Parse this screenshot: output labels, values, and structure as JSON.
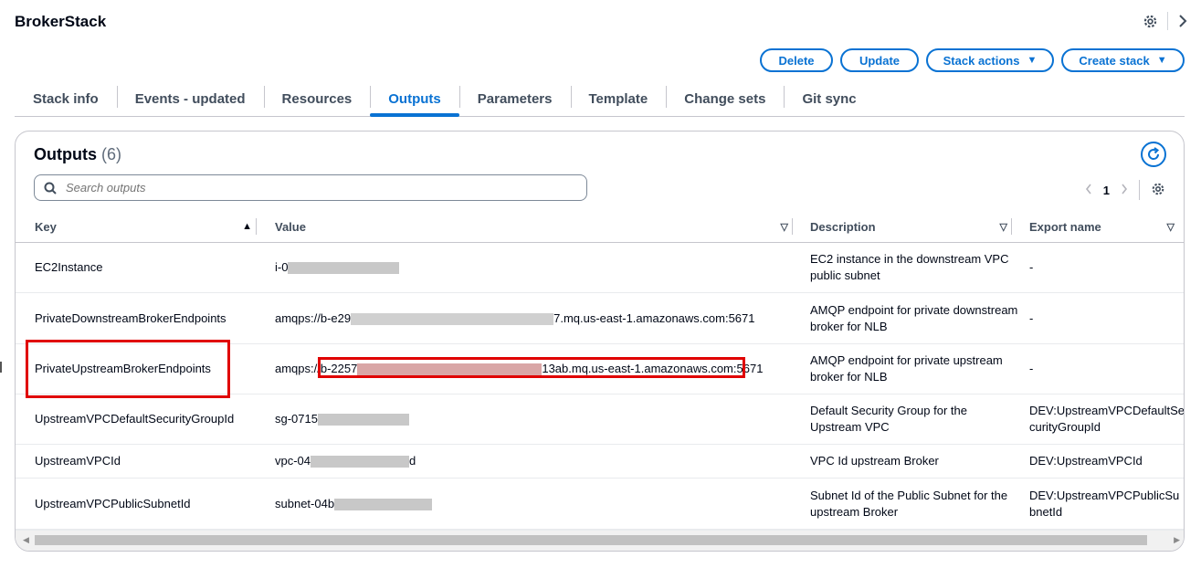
{
  "header": {
    "title": "BrokerStack"
  },
  "actions": {
    "delete": "Delete",
    "update": "Update",
    "stack_actions": "Stack actions",
    "create_stack": "Create stack"
  },
  "tabs": [
    {
      "label": "Stack info"
    },
    {
      "label": "Events - updated"
    },
    {
      "label": "Resources"
    },
    {
      "label": "Outputs",
      "active": true
    },
    {
      "label": "Parameters"
    },
    {
      "label": "Template"
    },
    {
      "label": "Change sets"
    },
    {
      "label": "Git sync"
    }
  ],
  "outputs": {
    "title": "Outputs",
    "count": "(6)",
    "search_placeholder": "Search outputs",
    "page": "1",
    "columns": {
      "key": "Key",
      "value": "Value",
      "description": "Description",
      "export": "Export name"
    },
    "rows": [
      {
        "key": "EC2Instance",
        "value_prefix": "i-0",
        "value_suffix": "",
        "description": "EC2 instance in the downstream VPC public subnet",
        "export": "-"
      },
      {
        "key": "PrivateDownstreamBrokerEndpoints",
        "value_prefix": "amqps://b-e29",
        "value_suffix": "7.mq.us-east-1.amazonaws.com:5671",
        "description": "AMQP endpoint for private downstream broker for NLB",
        "export": "-"
      },
      {
        "key": "PrivateUpstreamBrokerEndpoints",
        "value_prefix": "amqps://b-2257",
        "value_suffix": "13ab.mq.us-east-1.amazonaws.com:5671",
        "description": "AMQP endpoint for private upstream broker for NLB",
        "export": "-"
      },
      {
        "key": "UpstreamVPCDefaultSecurityGroupId",
        "value_prefix": "sg-0715",
        "value_suffix": "",
        "description": "Default Security Group for the Upstream VPC",
        "export": "DEV:UpstreamVPCDefaultSecurityGroupId"
      },
      {
        "key": "UpstreamVPCId",
        "value_prefix": "vpc-04",
        "value_suffix": "d",
        "description": "VPC Id upstream Broker",
        "export": "DEV:UpstreamVPCId"
      },
      {
        "key": "UpstreamVPCPublicSubnetId",
        "value_prefix": "subnet-04b",
        "value_suffix": "",
        "description": "Subnet Id of the Public Subnet for the upstream Broker",
        "export": "DEV:UpstreamVPCPublicSubnetId"
      }
    ]
  },
  "colors": {
    "accent": "#0972d3",
    "highlight": "#e00000",
    "text": "#000716",
    "border": "#c6c6cd"
  },
  "icons": {
    "settings": "gear-icon",
    "expand": "chevron-right-icon",
    "search": "search-icon",
    "refresh": "refresh-icon",
    "sort_asc": "sort-ascending-icon",
    "filter": "caret-down-icon"
  }
}
